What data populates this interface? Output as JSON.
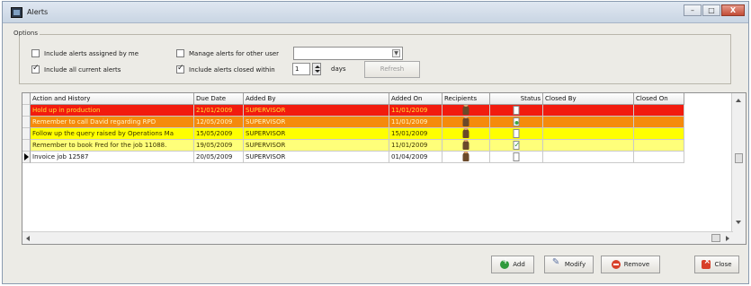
{
  "window": {
    "title": "Alerts",
    "caption_buttons": [
      "–",
      "□",
      "X"
    ]
  },
  "options": {
    "legend": "Options",
    "assigned_by_me": {
      "label": "Include alerts assigned by me",
      "checked": false
    },
    "all_current": {
      "label": "Include all current alerts",
      "checked": true
    },
    "manage_other_user": {
      "label": "Manage alerts for other user",
      "checked": false,
      "value": ""
    },
    "closed_within": {
      "label": "Include alerts closed within",
      "checked": true,
      "value": "1",
      "unit": "days"
    },
    "refresh_label": "Refresh"
  },
  "grid": {
    "columns": [
      "Action and History",
      "Due Date",
      "Added By",
      "Added On",
      "Recipients",
      "Status",
      "Closed By",
      "Closed On"
    ],
    "rows": [
      {
        "action": "Hold up in production",
        "due": "21/01/2009",
        "by": "SUPERVISOR",
        "on": "11/01/2009",
        "recipient_icon": "person-icon",
        "status_icon": "document-icon",
        "closed_by": "",
        "closed_on": "",
        "bg": "#f21b0e",
        "fg": "#ffe033"
      },
      {
        "action": "Remember to call David regarding RPD",
        "due": "12/05/2009",
        "by": "SUPERVISOR",
        "on": "11/01/2009",
        "recipient_icon": "person-icon",
        "status_icon": "document-ok-icon",
        "closed_by": "",
        "closed_on": "",
        "bg": "#f58a0c",
        "fg": "#fff6c8"
      },
      {
        "action": "Follow up the query raised by Operations Ma",
        "due": "15/05/2009",
        "by": "SUPERVISOR",
        "on": "15/01/2009",
        "recipient_icon": "person-icon",
        "status_icon": "document-icon",
        "closed_by": "",
        "closed_on": "",
        "bg": "#ffff00",
        "fg": "#3a3200"
      },
      {
        "action": "Remember to book Fred for the job 11088.",
        "due": "19/05/2009",
        "by": "SUPERVISOR",
        "on": "11/01/2009",
        "recipient_icon": "person-icon",
        "status_icon": "document-check-icon",
        "closed_by": "",
        "closed_on": "",
        "bg": "#ffff7a",
        "fg": "#3a3200"
      },
      {
        "action": "Invoice job 12587",
        "due": "20/05/2009",
        "by": "SUPERVISOR",
        "on": "01/04/2009",
        "recipient_icon": "person-icon",
        "status_icon": "document-icon",
        "closed_by": "",
        "closed_on": "",
        "bg": "#ffffff",
        "fg": "#1a1a1a"
      }
    ]
  },
  "buttons": {
    "add": "Add",
    "modify": "Modify",
    "remove": "Remove",
    "close": "Close"
  }
}
